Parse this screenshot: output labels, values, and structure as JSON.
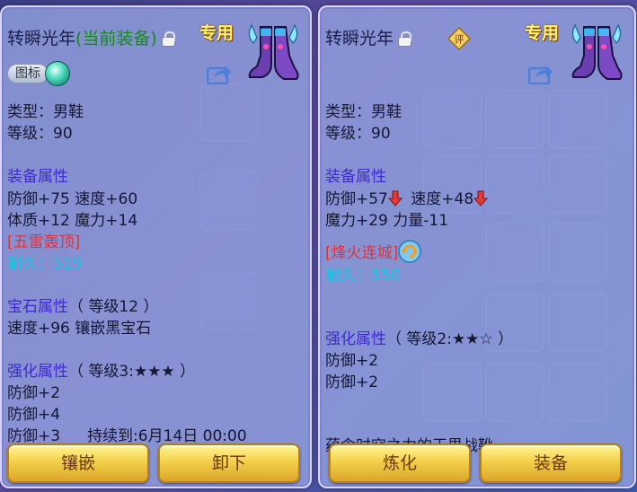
{
  "left": {
    "title": "转瞬光年",
    "status": "(当前装备)",
    "exclusive": "专用",
    "badge": "图标",
    "type": "类型：男鞋",
    "level": "等级：90",
    "equip_attr_header": "装备属性",
    "attr1": "防御+75 速度+60",
    "attr2": "体质+12 魔力+14",
    "special": "[五雷轰顶]",
    "durability": "耐久：519",
    "gem_header": "宝石属性",
    "gem_level": "（ 等级12 ）",
    "gem_line": "速度+96 镶嵌黑宝石",
    "enhance_header": "强化属性",
    "enhance_level": "（ 等级3:★★★ ）",
    "enh1": "防御+2",
    "enh2": "防御+4",
    "enh3": "防御+3",
    "duration": "持续到:6月14日 00:00",
    "button_left": "镶嵌",
    "button_right": "卸下"
  },
  "right": {
    "title": "转瞬光年",
    "exclusive": "专用",
    "rate_icon_text": "评",
    "type": "类型：男鞋",
    "level": "等级：90",
    "equip_attr_header": "装备属性",
    "attr1a": "防御+57",
    "attr1b": "速度+48",
    "attr2": "魔力+29 力量-11",
    "special": "[烽火连城]",
    "durability": "耐久：550",
    "enhance_header": "强化属性",
    "enhance_level": "（ 等级2:★★☆ ）",
    "enh1": "防御+2",
    "enh2": "防御+2",
    "desc": "蕴含时空之力的天界战靴",
    "button_left": "炼化",
    "button_right": "装备"
  },
  "colors": {
    "header_blue": "#3d2ad0",
    "special_red": "#e0323a",
    "durability_cyan": "#10c7e6",
    "current_green": "#148a1b",
    "exclusive_yellow": "#fff36a"
  },
  "icons": {
    "item": "winged-boots-icon",
    "share": "share-icon",
    "lock": "lock-icon",
    "decrease": "red-down-arrow-icon",
    "refresh": "refresh-icon"
  }
}
